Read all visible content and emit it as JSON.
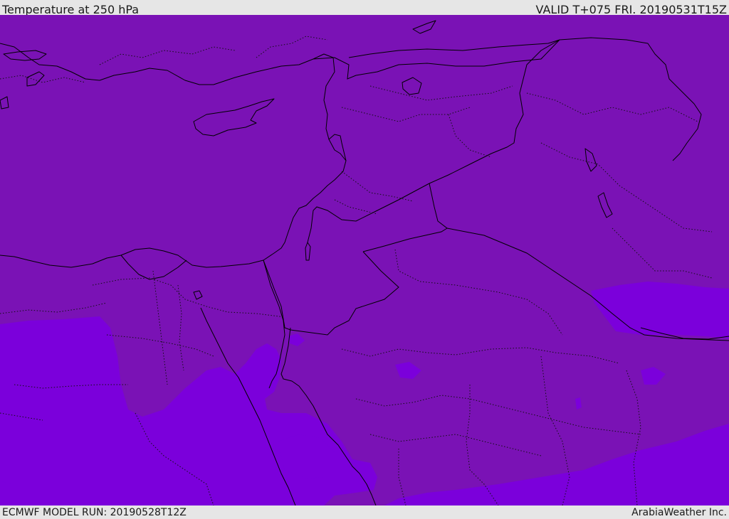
{
  "header": {
    "title": "Temperature at 250 hPa",
    "valid": "VALID T+075 FRI. 20190531T15Z"
  },
  "footer": {
    "model_run": "ECMWF MODEL RUN: 20190528T12Z",
    "provider": "ArabiaWeather Inc."
  },
  "map": {
    "colors": {
      "base_fill": "#7a12b5",
      "cold_fill": "#7b00db",
      "lines": "#000000"
    }
  }
}
